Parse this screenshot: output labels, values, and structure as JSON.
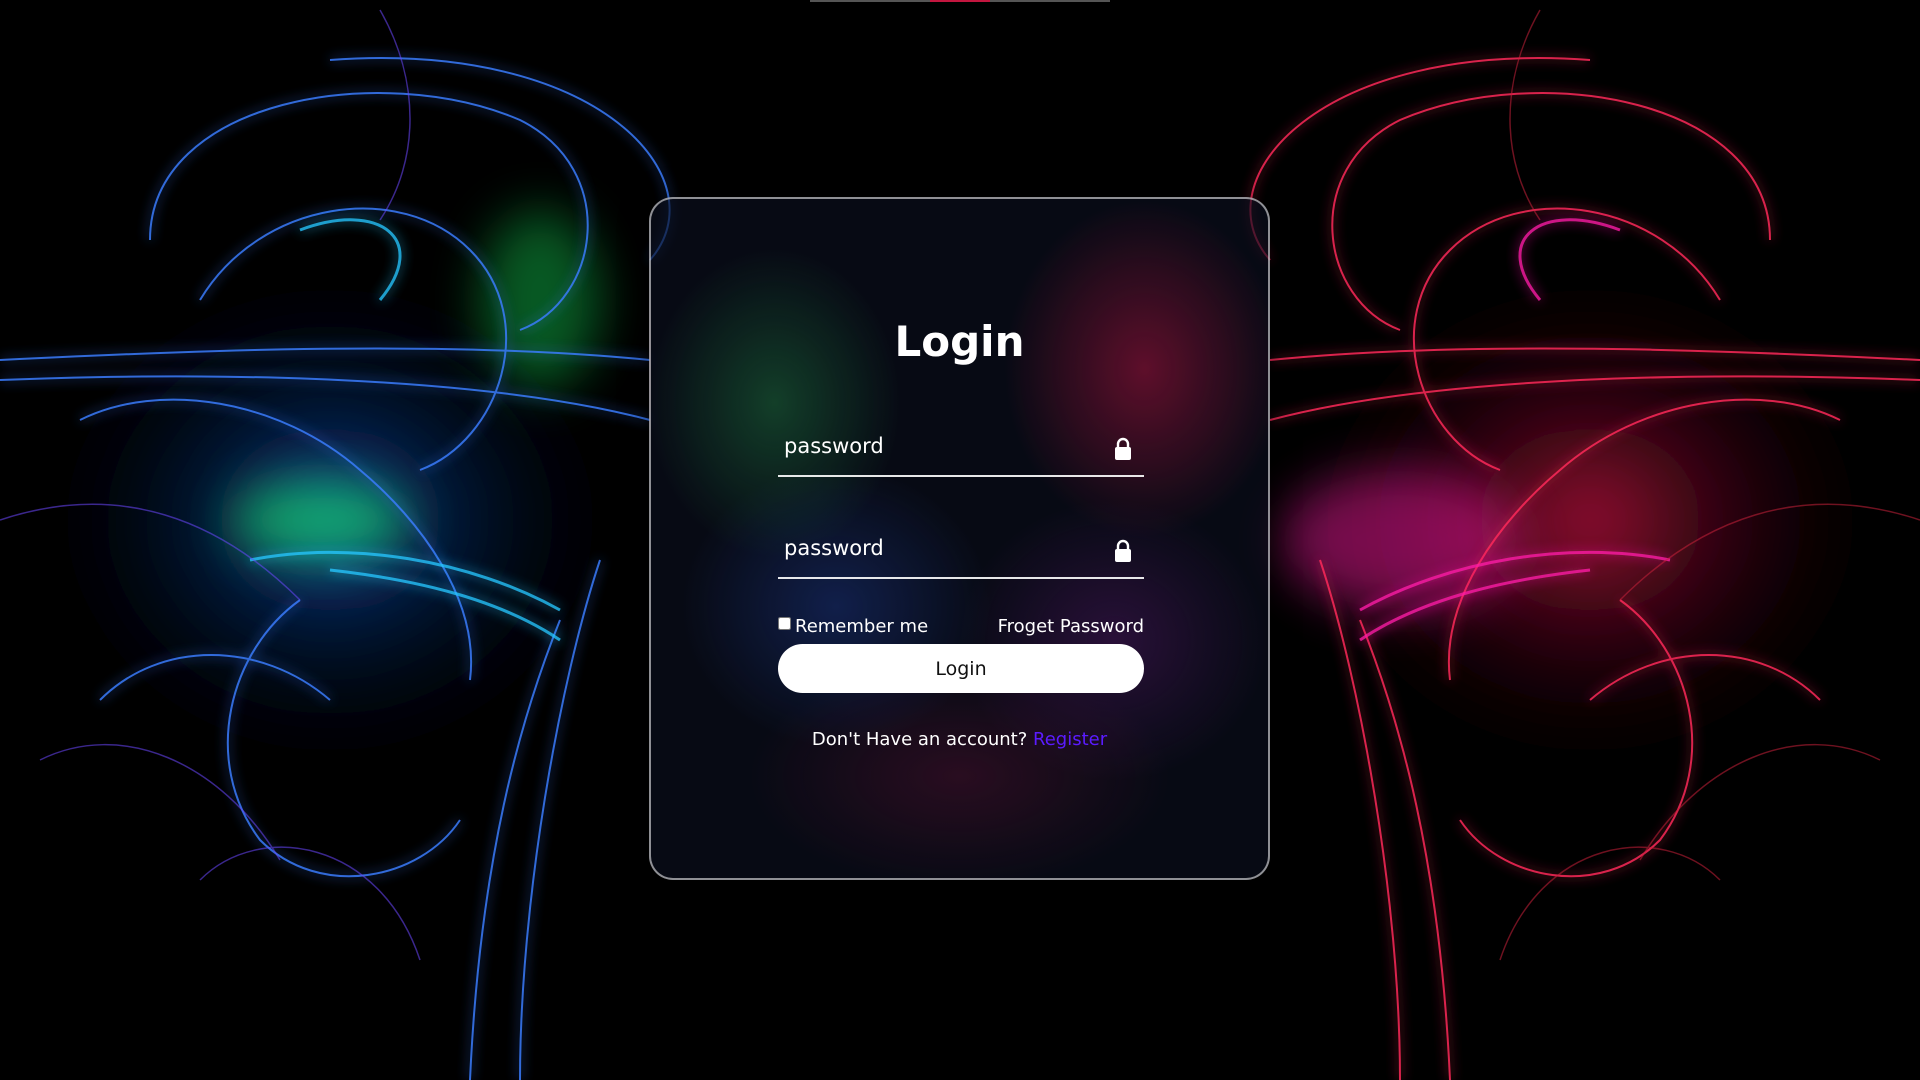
{
  "form": {
    "title": "Login",
    "fields": [
      {
        "placeholder": "password",
        "icon": "lock-icon"
      },
      {
        "placeholder": "password",
        "icon": "lock-icon"
      }
    ],
    "remember_label": "Remember me",
    "forgot_label": "Froget Password",
    "login_label": "Login",
    "register_prompt": "Don't Have an account?",
    "register_link": "Register"
  },
  "colors": {
    "accent_link": "#5b1bff",
    "button_bg": "#ffffff",
    "background": "#000000"
  }
}
